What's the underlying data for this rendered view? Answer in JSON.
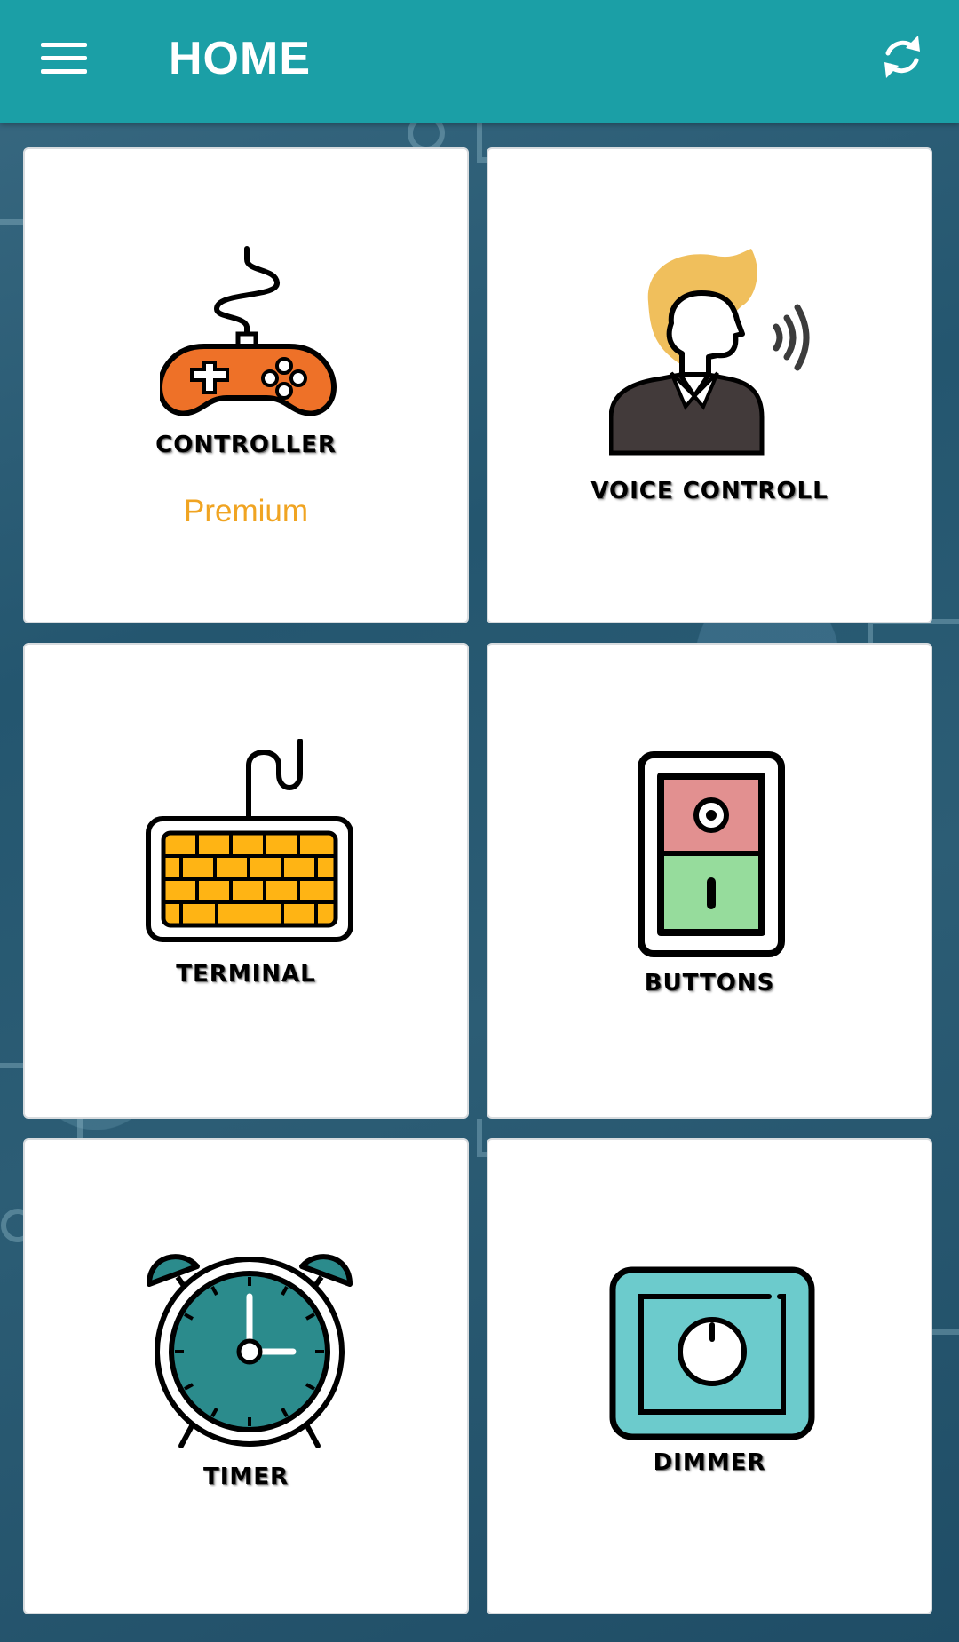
{
  "appbar": {
    "title": "HOME",
    "menu_icon": "hamburger-menu-icon",
    "refresh_icon": "refresh-icon",
    "color": "#1b9fa6"
  },
  "cards": [
    {
      "label": "CONTROLLER",
      "badge": "Premium",
      "icon": "gamepad-icon",
      "accent": "#ee7128"
    },
    {
      "label": "VOICE CONTROLL",
      "icon": "speaking-person-icon",
      "accent": "#f0bf5c"
    },
    {
      "label": "TERMINAL",
      "icon": "keyboard-icon",
      "accent": "#ffb414"
    },
    {
      "label": "BUTTONS",
      "icon": "switch-icon",
      "accent": "#e29090"
    },
    {
      "label": "TIMER",
      "icon": "alarm-clock-icon",
      "accent": "#2b8b8c"
    },
    {
      "label": "DIMMER",
      "icon": "dimmer-knob-icon",
      "accent": "#6ccbcc"
    }
  ]
}
